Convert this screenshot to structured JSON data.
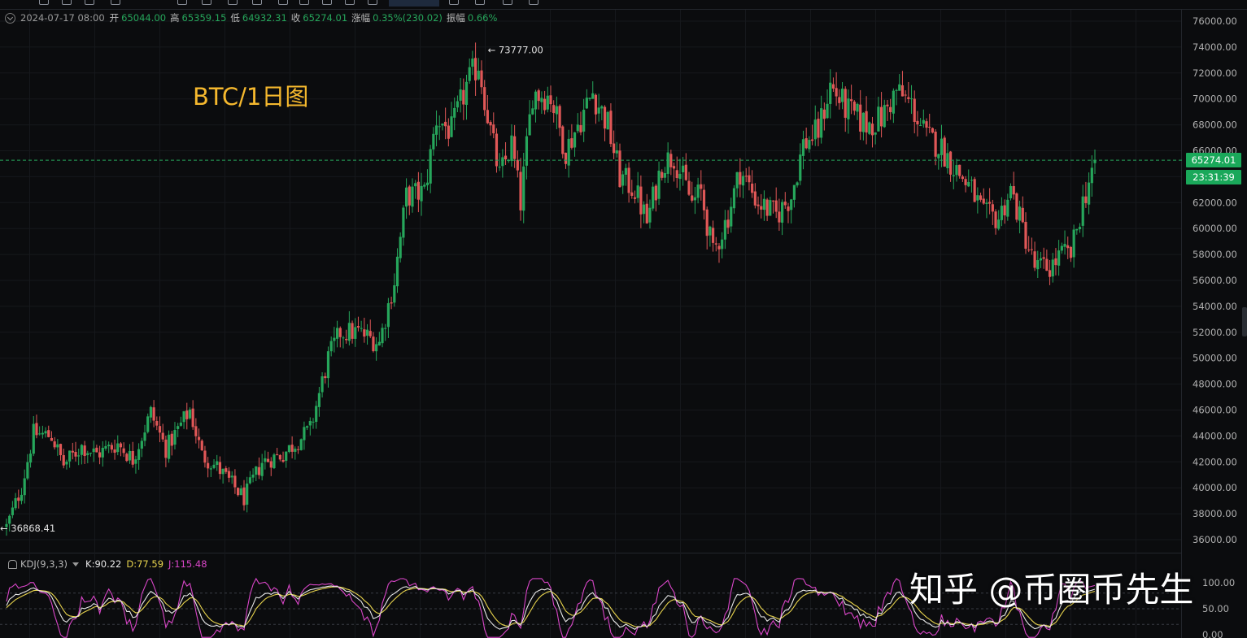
{
  "info_bar": {
    "date": "2024-07-17 08:00",
    "open_label": "开",
    "open": "65044.00",
    "high_label": "高",
    "high": "65359.15",
    "low_label": "低",
    "low": "64932.31",
    "close_label": "收",
    "close": "65274.01",
    "change_label": "涨幅",
    "change": "0.35%(230.02)",
    "amplitude_label": "振幅",
    "amplitude": "0.66%"
  },
  "chart_title": "BTC/1日图",
  "watermark": "知乎 @币圈币先生",
  "kdj": {
    "name": "KDJ(9,3,3)",
    "k_text": "K:90.22",
    "d_text": "D:77.59",
    "j_text": "J:115.48"
  },
  "current_price_badge": "65274.01",
  "countdown_badge": "23:31:39",
  "colors": {
    "up": "#26a65b",
    "down": "#e05757",
    "k": "#e8e8e8",
    "d": "#e8d44d",
    "j": "#d946c8",
    "accent": "#f5b82e"
  },
  "chart_data": [
    {
      "type": "candlestick",
      "title": "BTC/1日图",
      "y_ticks": [
        "76000.00",
        "74000.00",
        "72000.00",
        "70000.00",
        "68000.00",
        "66000.00",
        "64000.00",
        "62000.00",
        "60000.00",
        "58000.00",
        "56000.00",
        "54000.00",
        "52000.00",
        "50000.00",
        "48000.00",
        "46000.00",
        "44000.00",
        "42000.00",
        "40000.00",
        "38000.00",
        "36000.00"
      ],
      "ylim": [
        35000,
        76500
      ],
      "current_price": 65274.01,
      "high_marker": {
        "value": 73777.0,
        "text": "73777.00"
      },
      "low_marker": {
        "value": 36868.41,
        "text": "36868.41"
      },
      "anchors": [
        [
          0,
          37000
        ],
        [
          5,
          40000
        ],
        [
          9,
          44200
        ],
        [
          15,
          44000
        ],
        [
          19,
          41800
        ],
        [
          25,
          43200
        ],
        [
          30,
          42600
        ],
        [
          37,
          43400
        ],
        [
          42,
          42200
        ],
        [
          48,
          45800
        ],
        [
          53,
          43000
        ],
        [
          61,
          46000
        ],
        [
          65,
          42500
        ],
        [
          70,
          41600
        ],
        [
          79,
          39200
        ],
        [
          85,
          42000
        ],
        [
          92,
          42600
        ],
        [
          101,
          44500
        ],
        [
          107,
          50000
        ],
        [
          111,
          52000
        ],
        [
          117,
          52000
        ],
        [
          124,
          51200
        ],
        [
          129,
          56000
        ],
        [
          133,
          62500
        ],
        [
          139,
          62800
        ],
        [
          143,
          68500
        ],
        [
          148,
          67500
        ],
        [
          153,
          71000
        ],
        [
          157,
          72800
        ],
        [
          161,
          67500
        ],
        [
          164,
          64000
        ],
        [
          168,
          66500
        ],
        [
          171,
          62000
        ],
        [
          175,
          70500
        ],
        [
          181,
          70200
        ],
        [
          186,
          66000
        ],
        [
          190,
          68000
        ],
        [
          195,
          70500
        ],
        [
          200,
          68000
        ],
        [
          204,
          64000
        ],
        [
          209,
          63000
        ],
        [
          213,
          60500
        ],
        [
          218,
          65000
        ],
        [
          222,
          65600
        ],
        [
          228,
          62000
        ],
        [
          231,
          62800
        ],
        [
          235,
          58000
        ],
        [
          240,
          61000
        ],
        [
          244,
          64500
        ],
        [
          250,
          62000
        ],
        [
          256,
          61000
        ],
        [
          261,
          62500
        ],
        [
          265,
          66500
        ],
        [
          270,
          67500
        ],
        [
          274,
          71000
        ],
        [
          280,
          69000
        ],
        [
          286,
          68000
        ],
        [
          291,
          68500
        ],
        [
          296,
          70600
        ],
        [
          301,
          69500
        ],
        [
          306,
          67000
        ],
        [
          310,
          66500
        ],
        [
          316,
          64500
        ],
        [
          321,
          63000
        ],
        [
          325,
          61000
        ],
        [
          330,
          60800
        ],
        [
          334,
          63000
        ],
        [
          338,
          60000
        ],
        [
          342,
          57000
        ],
        [
          347,
          57000
        ],
        [
          351,
          58000
        ],
        [
          354,
          58000
        ],
        [
          358,
          62000
        ],
        [
          362,
          65274
        ]
      ]
    },
    {
      "type": "line",
      "title": "KDJ(9,3,3)",
      "y_ticks": [
        "100.00",
        "50.00",
        "0.00"
      ],
      "ylim": [
        0,
        100
      ],
      "series_names": [
        "K",
        "D",
        "J"
      ]
    }
  ]
}
